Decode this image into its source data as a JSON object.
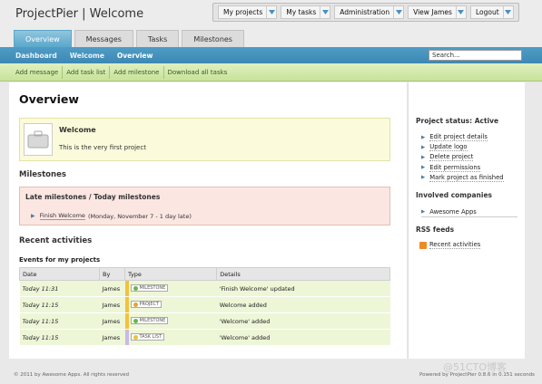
{
  "app": {
    "title": "ProjectPier | Welcome"
  },
  "topnav": [
    {
      "label": "My projects"
    },
    {
      "label": "My tasks"
    },
    {
      "label": "Administration"
    },
    {
      "label": "View James"
    },
    {
      "label": "Logout"
    }
  ],
  "tabs": [
    {
      "label": "Overview",
      "active": true
    },
    {
      "label": "Messages"
    },
    {
      "label": "Tasks"
    },
    {
      "label": "Milestones"
    }
  ],
  "breadcrumb": [
    "Dashboard",
    "Welcome",
    "Overview"
  ],
  "search": {
    "value": "Search..."
  },
  "actions": [
    "Add message",
    "Add task list",
    "Add milestone",
    "Download all tasks"
  ],
  "main": {
    "title": "Overview",
    "project": {
      "name": "Welcome",
      "description": "This is the very first project"
    },
    "milestones": {
      "heading": "Milestones",
      "late_title": "Late milestones / Today milestones",
      "items": [
        {
          "link": "Finish Welcome",
          "meta": "(Monday, November 7 - 1 day late)"
        }
      ]
    },
    "recent": {
      "heading": "Recent activities",
      "subheading": "Events for my projects"
    },
    "table": {
      "headers": [
        "Date",
        "By",
        "Type",
        "Details"
      ],
      "rows": [
        {
          "date": "Today 11:31",
          "by": "James",
          "type": "MILESTONE",
          "details": "'Finish Welcome' updated",
          "color": "#f3c23a",
          "dot": "#6bb54a"
        },
        {
          "date": "Today 11:15",
          "by": "James",
          "type": "PROJECT",
          "details": "Welcome added",
          "color": "#f3c23a",
          "dot": "#e0a43a"
        },
        {
          "date": "Today 11:15",
          "by": "James",
          "type": "MILESTONE",
          "details": "'Welcome' added",
          "color": "#f3c23a",
          "dot": "#6bb54a"
        },
        {
          "date": "Today 11:15",
          "by": "James",
          "type": "TASK LIST",
          "details": "'Welcome' added",
          "color": "#c9b8e8",
          "dot": "#e8c23a"
        }
      ]
    }
  },
  "sidebar": {
    "status_heading": "Project status: Active",
    "links": [
      "Edit project details",
      "Update logo",
      "Delete project",
      "Edit permissions",
      "Mark project as finished"
    ],
    "companies_heading": "Involved companies",
    "company": "Awesome Apps",
    "rss_heading": "RSS feeds",
    "rss_link": "Recent activities"
  },
  "footer": {
    "left": "© 2011 by Awesome Apps. All rights reserved",
    "right": "Powered by ProjectPier 0.8.6 in 0.151 seconds"
  },
  "watermark": "@51CTO博客"
}
